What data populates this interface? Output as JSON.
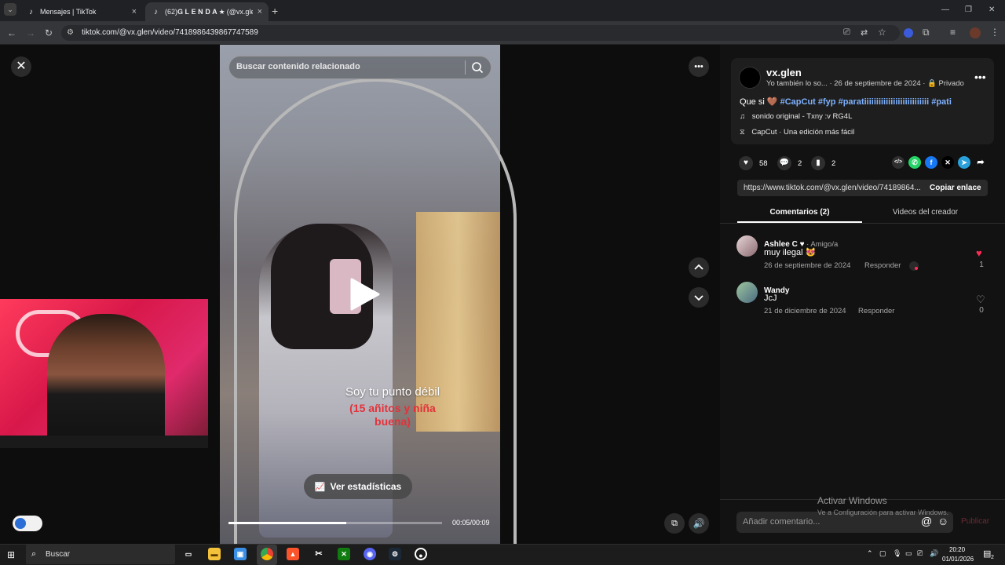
{
  "browser": {
    "tabs": [
      {
        "label": "Mensajes | TikTok",
        "close": "×"
      },
      {
        "label": "(62)𝐆 𝐋 𝐄 𝐍 𝐃 𝐀 ★ (@vx.gle",
        "close": "×"
      }
    ],
    "new_tab": "+",
    "url": "tiktok.com/@vx.glen/video/7418986439867747589",
    "window_controls": {
      "minimize": "—",
      "restore": "❐",
      "close": "✕"
    }
  },
  "video_view": {
    "close": "✕",
    "search_placeholder": "Buscar contenido relacionado",
    "overlay_line1": "Soy tu punto débil",
    "overlay_line2": "(15 añitos y niña buena)",
    "stats_label": "Ver estadísticas",
    "time": "00:05/00:09",
    "progress_fraction": 0.55,
    "more": "•••",
    "nav_up": "⌃",
    "nav_down": "⌄"
  },
  "post": {
    "username": "vx.glen",
    "subline": "Yo también lo so... · 26 de septiembre de 2024 · 🔒 Privado",
    "more": "•••",
    "caption_prefix": "Que si 🤎 ",
    "hashtags": [
      "#CapCut",
      "#fyp",
      "#paratiiiiiiiiiiiiiiiiiiiiiiiiiii",
      "#pati"
    ],
    "sound": "sonido original - Txny :v RG4L",
    "capcut": "CapCut · Una edición más fácil",
    "likes": "58",
    "comments": "2",
    "saves": "2",
    "link": "https://www.tiktok.com/@vx.glen/video/74189864...",
    "copy_link": "Copiar enlace",
    "tab_comments": "Comentarios (2)",
    "tab_creator": "Videos del creador"
  },
  "comments": [
    {
      "name": "Ashlee C ♥",
      "relation": " · Amigo/a",
      "text": "muy ilegal 😻",
      "date": "26 de septiembre de 2024",
      "reply": "Responder",
      "likes": "1",
      "liked": true
    },
    {
      "name": "Wandy",
      "relation": "",
      "text": "JcJ",
      "date": "21 de diciembre de 2024",
      "reply": "Responder",
      "likes": "0",
      "liked": false
    }
  ],
  "comment_box": {
    "placeholder": "Añadir comentario...",
    "post": "Publicar"
  },
  "windows_activation": {
    "line1": "Activar Windows",
    "line2": "Ve a Configuración para activar Windows."
  },
  "taskbar": {
    "search": "Buscar",
    "time": "20:20",
    "date": "01/01/2026",
    "notification_count": "2"
  },
  "colors": {
    "accent_red": "#fe2c55",
    "hashtag": "#7fb2ff",
    "panel_bg": "#121212"
  }
}
